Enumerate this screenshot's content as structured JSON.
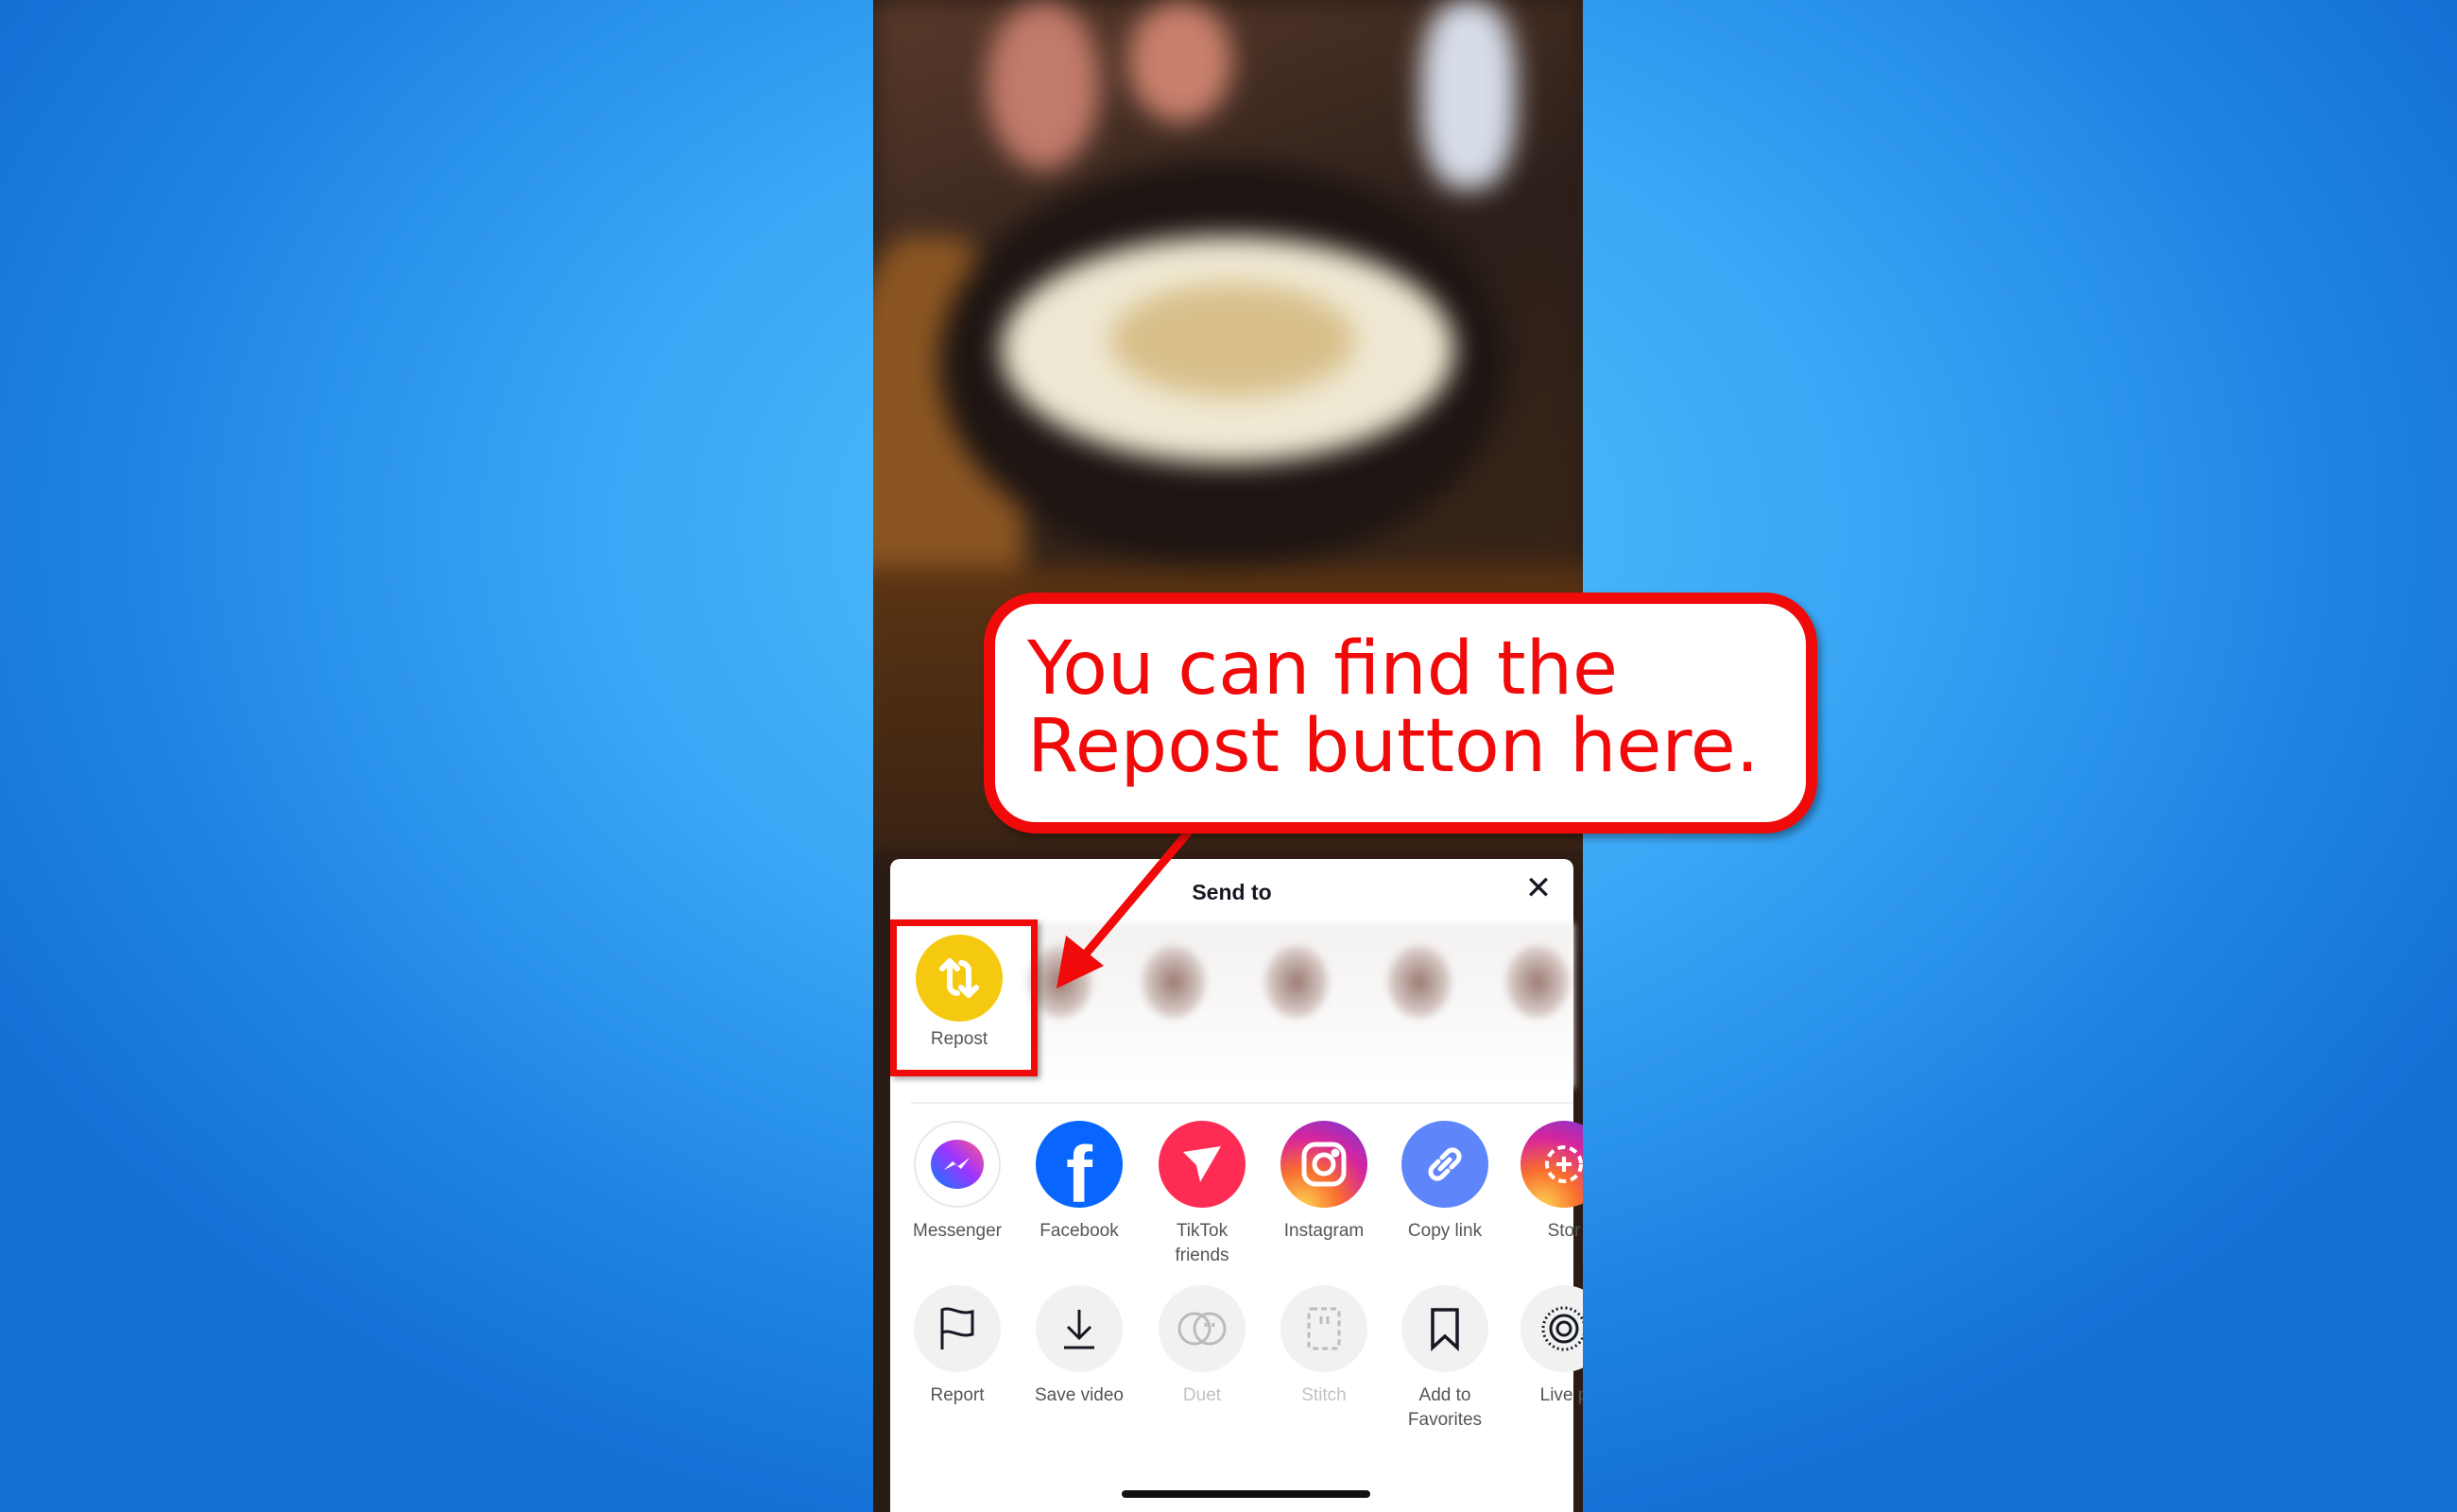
{
  "sheet": {
    "title": "Send to",
    "close_icon": "close-icon",
    "repost": {
      "label": "Repost",
      "icon": "repost-icon",
      "color": "#f5c90f"
    },
    "share_row": [
      {
        "label": "Messenger",
        "icon": "messenger-icon"
      },
      {
        "label": "Facebook",
        "icon": "facebook-icon",
        "color": "#0866ff"
      },
      {
        "label": "TikTok friends",
        "icon": "send-icon",
        "color": "#fe2c55"
      },
      {
        "label": "Instagram",
        "icon": "instagram-icon"
      },
      {
        "label": "Copy link",
        "icon": "link-icon",
        "color": "#5f85fb"
      },
      {
        "label": "Stor",
        "icon": "story-icon"
      }
    ],
    "action_row": [
      {
        "label": "Report",
        "icon": "flag-icon"
      },
      {
        "label": "Save video",
        "icon": "download-icon"
      },
      {
        "label": "Duet",
        "icon": "duet-icon",
        "disabled": true
      },
      {
        "label": "Stitch",
        "icon": "stitch-icon",
        "disabled": true
      },
      {
        "label": "Add to Favorites",
        "icon": "bookmark-icon"
      },
      {
        "label": "Live p",
        "icon": "live-photo-icon"
      }
    ]
  },
  "annotation": {
    "text": "You can find the Repost button here.",
    "color": "#f00a0a"
  }
}
